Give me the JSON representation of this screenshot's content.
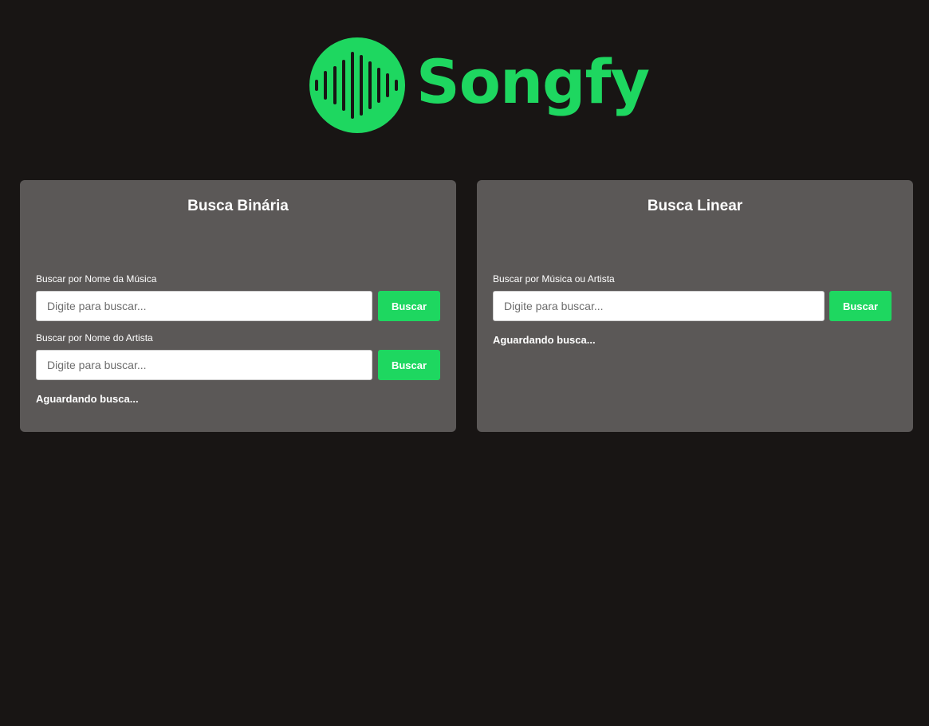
{
  "brand": {
    "name": "Songfy",
    "logo_icon": "sound-wave-icon",
    "accent_color": "#1ed760"
  },
  "binary_search": {
    "title": "Busca Binária",
    "song_label": "Buscar por Nome da Música",
    "song_placeholder": "Digite para buscar...",
    "song_button": "Buscar",
    "artist_label": "Buscar por Nome do Artista",
    "artist_placeholder": "Digite para buscar...",
    "artist_button": "Buscar",
    "status": "Aguardando busca..."
  },
  "linear_search": {
    "title": "Busca Linear",
    "label": "Buscar por Música ou Artista",
    "placeholder": "Digite para buscar...",
    "button": "Buscar",
    "status": "Aguardando busca..."
  }
}
